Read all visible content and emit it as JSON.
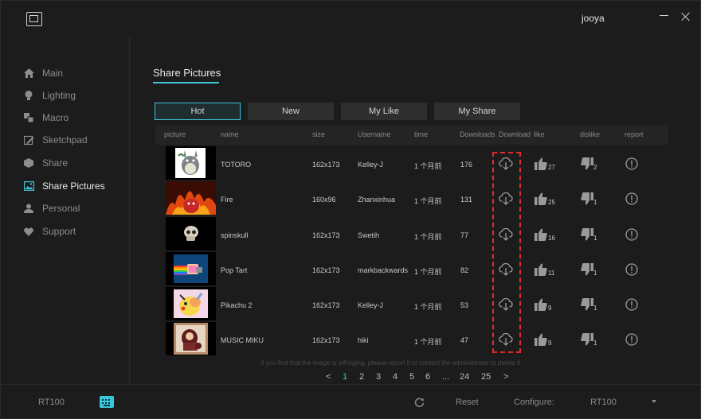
{
  "titlebar": {
    "username": "jooya"
  },
  "sidebar": {
    "items": [
      {
        "label": "Main",
        "icon": "home-icon"
      },
      {
        "label": "Lighting",
        "icon": "bulb-icon"
      },
      {
        "label": "Macro",
        "icon": "macro-icon"
      },
      {
        "label": "Sketchpad",
        "icon": "pencil-icon"
      },
      {
        "label": "Share",
        "icon": "share-icon"
      },
      {
        "label": "Share Pictures",
        "icon": "picture-icon"
      },
      {
        "label": "Personal",
        "icon": "user-icon"
      },
      {
        "label": "Support",
        "icon": "heart-icon"
      }
    ],
    "active": "Share Pictures"
  },
  "main": {
    "title": "Share Pictures",
    "tabs": [
      "Hot",
      "New",
      "My Like",
      "My Share"
    ],
    "active_tab": "Hot",
    "columns": [
      "picture",
      "name",
      "size",
      "Username",
      "time",
      "Downloads",
      "Download",
      "like",
      "dislike",
      "report"
    ],
    "rows": [
      {
        "name": "TOTORO",
        "size": "162x173",
        "username": "Kelley-J",
        "time": "1 个月前",
        "downloads": "176",
        "likes": "27",
        "dislikes": "2",
        "thumb": "totoro"
      },
      {
        "name": "Fire",
        "size": "160x96",
        "username": "Zhanxinhua",
        "time": "1 个月前",
        "downloads": "131",
        "likes": "25",
        "dislikes": "1",
        "thumb": "fire"
      },
      {
        "name": "spinskull",
        "size": "162x173",
        "username": "Swetih",
        "time": "1 个月前",
        "downloads": "77",
        "likes": "16",
        "dislikes": "1",
        "thumb": "skull"
      },
      {
        "name": "Pop Tart",
        "size": "162x173",
        "username": "markbackwards",
        "time": "1 个月前",
        "downloads": "82",
        "likes": "11",
        "dislikes": "1",
        "thumb": "nyan"
      },
      {
        "name": "Pikachu 2",
        "size": "162x173",
        "username": "Kelley-J",
        "time": "1 个月前",
        "downloads": "53",
        "likes": "9",
        "dislikes": "1",
        "thumb": "pikachu"
      },
      {
        "name": "MUSIC MIKU",
        "size": "162x173",
        "username": "hiki",
        "time": "1 个月前",
        "downloads": "47",
        "likes": "9",
        "dislikes": "1",
        "thumb": "miku"
      }
    ],
    "notice": "If you find that the image is infringing, please report it or contact the administrator to delete it",
    "pagination": {
      "prev": "<",
      "pages": [
        "1",
        "2",
        "3",
        "4",
        "5",
        "6",
        "...",
        "24",
        "25"
      ],
      "next": ">",
      "current": "1"
    }
  },
  "footer": {
    "device": "RT100",
    "reset": "Reset",
    "configure_label": "Configure:",
    "configure_value": "RT100"
  },
  "colors": {
    "accent": "#3ec3d8",
    "highlight": "#e22b2b",
    "background": "#1c1c1c"
  }
}
